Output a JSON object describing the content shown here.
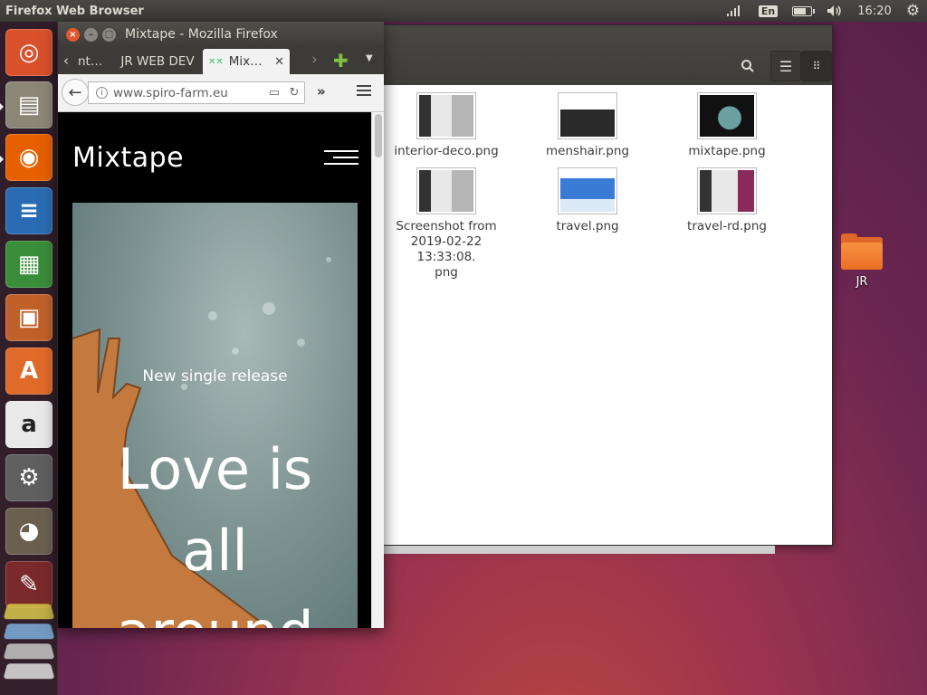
{
  "top_panel": {
    "app_title": "Firefox Web Browser",
    "keyboard_layout": "En",
    "clock": "16:20",
    "battery_level": 0.75,
    "icons": [
      "network-icon",
      "keyboard-icon",
      "battery-icon",
      "volume-icon",
      "gear-icon"
    ]
  },
  "launcher": {
    "items": [
      {
        "name": "dash-home",
        "icon": "ubuntu-icon",
        "color": "#d9512b",
        "glyph": "◎"
      },
      {
        "name": "files",
        "icon": "file-cabinet-icon",
        "color": "#8c8677",
        "glyph": "▤"
      },
      {
        "name": "firefox",
        "icon": "firefox-icon",
        "color": "#e66000",
        "glyph": "◉"
      },
      {
        "name": "writer",
        "icon": "writer-icon",
        "color": "#2a6cb3",
        "glyph": "≡"
      },
      {
        "name": "calc",
        "icon": "calc-icon",
        "color": "#3a8e3a",
        "glyph": "▦"
      },
      {
        "name": "impress",
        "icon": "impress-icon",
        "color": "#c0612a",
        "glyph": "▣"
      },
      {
        "name": "software-center",
        "icon": "shopping-bag-icon",
        "color": "#e06a2a",
        "glyph": "A"
      },
      {
        "name": "amazon",
        "icon": "amazon-icon",
        "color": "#e9e9e9",
        "glyph": "a"
      },
      {
        "name": "system-settings",
        "icon": "settings-icon",
        "color": "#5f5f5f",
        "glyph": "⚙"
      },
      {
        "name": "gimp",
        "icon": "gimp-icon",
        "color": "#6b6050",
        "glyph": "◕"
      },
      {
        "name": "wine",
        "icon": "wine-icon",
        "color": "#7a2a2a",
        "glyph": "✎"
      }
    ]
  },
  "files_window": {
    "files": [
      {
        "name": "interior-deco.png",
        "thumb": "light"
      },
      {
        "name": "menshair.png",
        "thumb": "dark"
      },
      {
        "name": "mixtape.png",
        "thumb": "black"
      },
      {
        "name": "Screenshot from 2019-02-22 13:33:08.png",
        "name_lines": [
          "Screenshot from",
          "2019-02-22 13:33:08.",
          "png"
        ],
        "thumb": "light"
      },
      {
        "name": "travel.png",
        "thumb": "blue"
      },
      {
        "name": "travel-rd.png",
        "thumb": "purple"
      }
    ]
  },
  "desktop": {
    "folder_label": "JR"
  },
  "firefox": {
    "window_title": "Mixtape - Mozilla Firefox",
    "tabs": [
      {
        "label": "nt…",
        "active": false
      },
      {
        "label": "JR WEB DEV",
        "active": false
      },
      {
        "label": "Mix…",
        "active": true
      }
    ],
    "url": "www.spiro-farm.eu",
    "page": {
      "logo": "Mixtape",
      "hero_subtitle": "New single release",
      "hero_title_lines": [
        "Love is",
        "all",
        "around"
      ]
    }
  }
}
